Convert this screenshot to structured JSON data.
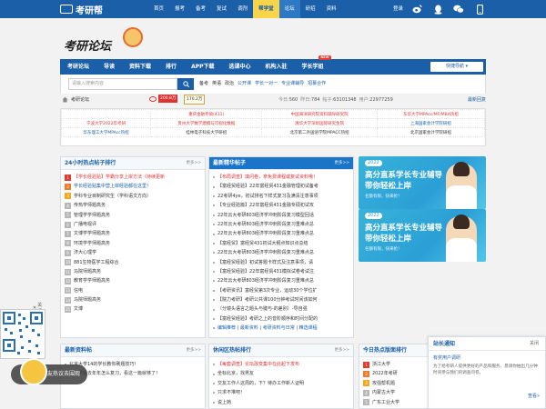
{
  "topbar": {
    "logo": "考研帮",
    "nav": [
      "首页",
      "报考",
      "备考",
      "复试",
      "调剂",
      "帮学堂",
      "论坛",
      "研招",
      "资料"
    ],
    "nav_hot_index": 5,
    "nav_active_index": 6,
    "login": "登录",
    "icons": [
      "weibo-icon",
      "qq-icon",
      "wechat-icon",
      "mobile-icon"
    ]
  },
  "banner": {
    "title": "考研论坛"
  },
  "mainnav": {
    "items": [
      "考研论坛",
      "导读",
      "资料下载",
      "排行",
      "APP下载",
      "选课中心",
      "机构入驻",
      "学长学姐"
    ],
    "new_badge": "NEW",
    "new_index": 7,
    "quick_nav": "快捷导航"
  },
  "search": {
    "placeholder": "请输入搜索内容",
    "hotwords": [
      "备考",
      "英语",
      "政治",
      "公开课",
      "学长一对一",
      "专业课辅导",
      "招募合作"
    ],
    "hot_blue": [
      3,
      4,
      5,
      6
    ]
  },
  "crumb": {
    "text": "考研论坛",
    "follow_count": "200.8万",
    "fav": "170.2万",
    "stats": [
      {
        "label": "今日:",
        "value": "560"
      },
      {
        "label": "昨日:",
        "value": "784"
      },
      {
        "label": "帖子:",
        "value": "63101348"
      },
      {
        "label": "用户:",
        "value": "22977259"
      }
    ],
    "rss": "最新回复"
  },
  "linkgrid": {
    "rows": [
      [
        {
          "text": "",
          "color": "dark"
        },
        {
          "text": "重庆金融专硕(431)",
          "color": "red"
        },
        {
          "text": "中国海洋研究院资料辅导研究院",
          "color": "red"
        },
        {
          "text": "东华大学MPAcc/MF/MBA热招",
          "color": "red"
        }
      ],
      [
        {
          "text": "宁波大学2022年考研",
          "color": "red"
        },
        {
          "text": "贵州大学数学建模与可视化数据",
          "color": "red"
        },
        {
          "text": "清华大学深圳国际研究生院",
          "color": "red"
        },
        {
          "text": "上海国家会计学院研招",
          "color": "blue"
        }
      ],
      [
        {
          "text": "华东理工大学MPAcc热招",
          "color": "blue"
        },
        {
          "text": "桂林电子科技大学研招",
          "color": "dark"
        },
        {
          "text": "北京第二外国语学院MPACC热招",
          "color": "dark"
        },
        {
          "text": "北京国家会计学院研招",
          "color": "dark"
        }
      ]
    ]
  },
  "hot24": {
    "title": "24小时热点帖子排行",
    "more": "更多>>",
    "items": [
      {
        "text": "【学长经验贴】学霸分享上岸方法（持续更新",
        "color": "red"
      },
      {
        "text": "学长经验贴集中营上岸经验都在这里！",
        "color": "blue"
      },
      {
        "text": "学科专业目制研究生（学科语文方向）",
        "color": "dark"
      },
      {
        "text": "传热学师题高务",
        "color": "dark"
      },
      {
        "text": "管理学学师题高务",
        "color": "dark"
      },
      {
        "text": "广播电视评",
        "color": "dark"
      },
      {
        "text": "文博学学师题高务",
        "color": "dark"
      },
      {
        "text": "环境学学师题高务",
        "color": "dark"
      },
      {
        "text": "济大心理学",
        "color": "dark"
      },
      {
        "text": "881生物医学工程综合",
        "color": "dark"
      },
      {
        "text": "马院师题高务",
        "color": "dark"
      },
      {
        "text": "教育学学师题高务",
        "color": "dark"
      },
      {
        "text": "信电",
        "color": "dark"
      },
      {
        "text": "马院师题高务",
        "color": "dark"
      },
      {
        "text": "文博",
        "color": "dark"
      }
    ]
  },
  "latest": {
    "title": "最新精华帖子",
    "more": "更多>>",
    "items": [
      {
        "text": "【布局调查】填问卷，拿免费课程或复试资料哦！",
        "color": "red"
      },
      {
        "text": "【富经贸经验】22年富经贸431金融管理初试备考",
        "color": "dark"
      },
      {
        "text": "22考研4ye，初试排名下样式复习及满清注意事项",
        "color": "dark"
      },
      {
        "text": "【专业经验篇】22年富经贸431金融专硕初试攻",
        "color": "dark"
      },
      {
        "text": "22年云大考研803经济学冲刺阶段复习模型回话",
        "color": "dark"
      },
      {
        "text": "22年云大考研803经济学冲刺阶段复习重难点总",
        "color": "dark"
      },
      {
        "text": "22年云大考研803经济学冲刺阶段复习重难点总",
        "color": "dark"
      },
      {
        "text": "【富经贸】富经贸431初试大纲点知识点总结",
        "color": "dark"
      },
      {
        "text": "22年云大考研803经济学冲刺阶段复习重难点总",
        "color": "dark"
      },
      {
        "text": "【富经贸经验】初试答题卡样式及注意事项，请",
        "color": "dark"
      },
      {
        "text": "【富经贸经验】22年富经贸431模拟试卷考试注",
        "color": "dark"
      },
      {
        "text": "22年云大考研803经济学冲刺阶段复习重难点总",
        "color": "dark"
      },
      {
        "text": "【考研资讯】富经贸第3次专业，运动30个学位扩",
        "color": "dark"
      },
      {
        "text": "【院力考研】考研公共课100分钟考试时间该如何",
        "color": "dark"
      },
      {
        "text": "（分镜头语言之题头与键与-的差别）-导自强",
        "color": "dark"
      },
      {
        "text": "【富经贸经验】考研之上的音阶顺序和时间分配的",
        "color": "dark"
      },
      {
        "text": "编辑推荐 | 最新资料 | 考研资料与日常 | 精选课程",
        "color": "blue"
      }
    ]
  },
  "ads": [
    {
      "year": "2022",
      "line1": "高分直系学长专业辅导",
      "line2": "带你轻松上岸",
      "line3": "名额有限，快来抢！"
    },
    {
      "year": "2022",
      "line1": "高分直系学长专业辅导",
      "line2": "带你轻松上岸",
      "line3": "名额有限，快来抢！"
    }
  ],
  "newres": {
    "title": "最新资料帖",
    "more": "更多>>",
    "items": [
      {
        "text": "北京大学14的学长教你刷题技巧！",
        "color": "dark"
      },
      {
        "text": "学长学姐去年年怎么复习，看这一篇就够了！",
        "color": "dark"
      }
    ]
  },
  "casual": {
    "title": "休闲区热帖排行",
    "more": "更多>>",
    "items": [
      {
        "text": "【每套调查】论坛改变集中在此起下发布",
        "color": "red"
      },
      {
        "text": "坐标北京，找男友",
        "color": "dark"
      },
      {
        "text": "交友工作人这周的，下？待办工作新人证明",
        "color": "dark"
      },
      {
        "text": "只求不堆吧！",
        "color": "dark"
      },
      {
        "text": "说上她",
        "color": "dark"
      }
    ]
  },
  "todayhot": {
    "title": "今日热点版面排行",
    "items": [
      {
        "text": "浙江大学",
        "color": "dark"
      },
      {
        "text": "2022年考研",
        "color": "dark"
      },
      {
        "text": "攻强帮机题",
        "color": "dark"
      },
      {
        "text": "内蒙古大学",
        "color": "dark"
      },
      {
        "text": "广东工业大学",
        "color": "dark"
      }
    ]
  },
  "notice": {
    "title": "站长通知",
    "close": "关闭",
    "subject": "有奖用户调研",
    "body": "为了给考研人提供更好的产品和服务，恳请你抽出几分钟时间参与我们的调查问卷。",
    "more": "查看»"
  },
  "qr": {
    "close": "关闭"
  },
  "toast": {
    "text": "研友热议去围观"
  },
  "colors": {
    "brand_blue": "#1a5fa7",
    "hot_yellow": "#f7d44a",
    "alert_red": "#e8392f"
  }
}
